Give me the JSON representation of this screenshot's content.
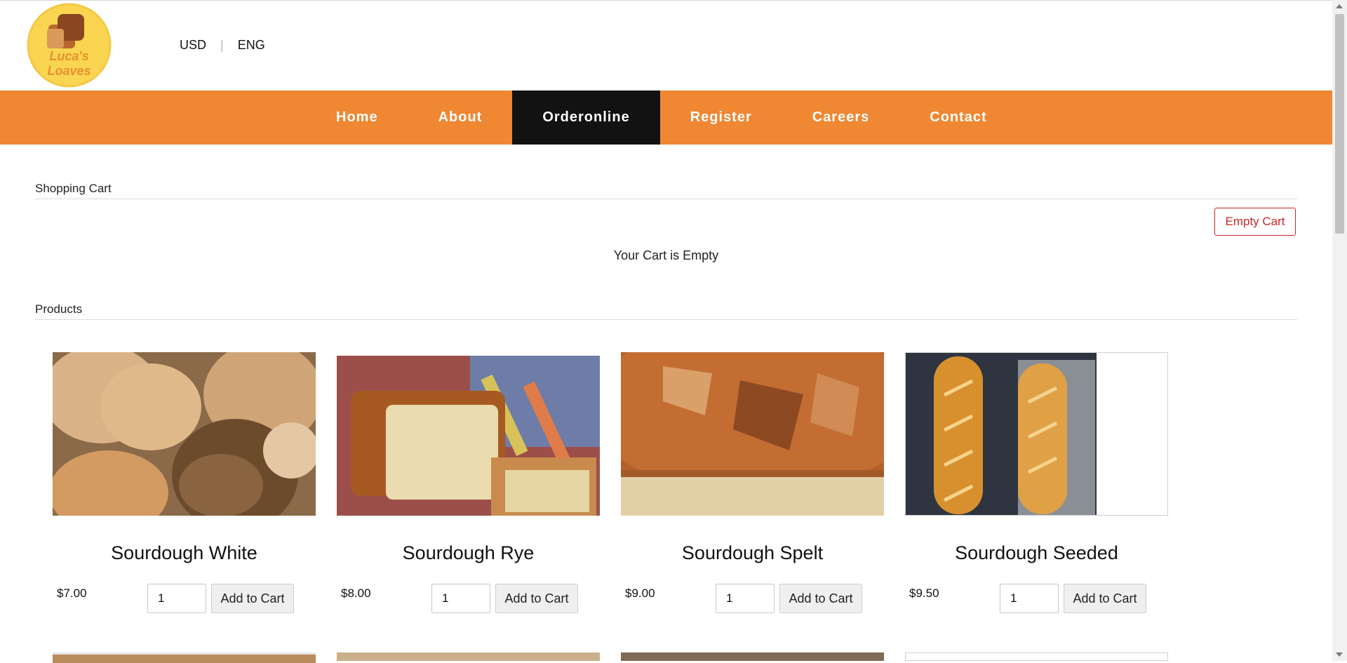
{
  "header": {
    "logo_text_line1": "Luca's",
    "logo_text_line2": "Loaves",
    "currency": "USD",
    "language": "ENG"
  },
  "nav": {
    "items": [
      "Home",
      "About",
      "Orderonline",
      "Register",
      "Careers",
      "Contact"
    ],
    "active": "Orderonline"
  },
  "cart": {
    "title": "Shopping Cart",
    "empty_button": "Empty Cart",
    "empty_message": "Your Cart is Empty"
  },
  "products_section": {
    "title": "Products",
    "add_label": "Add to Cart",
    "items": [
      {
        "name": "Sourdough White",
        "price": "$7.00",
        "qty": "1"
      },
      {
        "name": "Sourdough Rye",
        "price": "$8.00",
        "qty": "1"
      },
      {
        "name": "Sourdough Spelt",
        "price": "$9.00",
        "qty": "1"
      },
      {
        "name": "Sourdough Seeded",
        "price": "$9.50",
        "qty": "1"
      }
    ]
  },
  "colors": {
    "nav_bg": "#ef8733",
    "nav_active_bg": "#121212",
    "empty_cart_accent": "#c62828",
    "logo_yellow": "#f6c944"
  },
  "icons": [
    "bread-logo-icon",
    "scroll-up-icon",
    "scroll-down-icon"
  ]
}
